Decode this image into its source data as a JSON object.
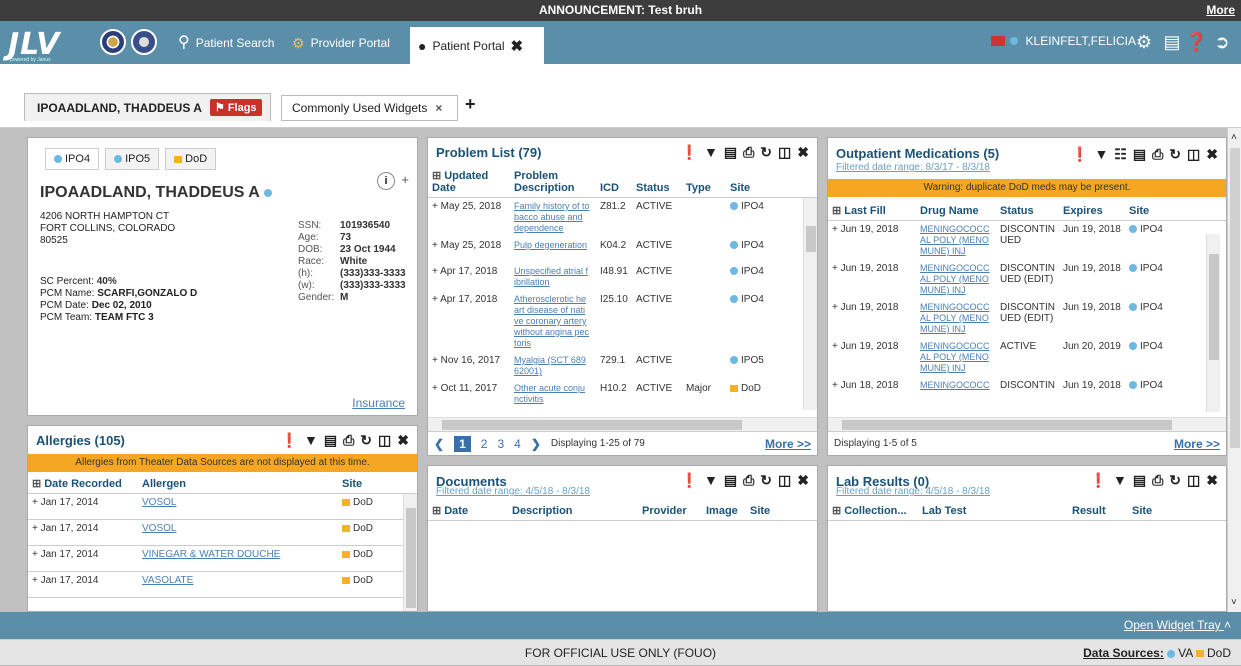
{
  "announcement": {
    "label": "ANNOUNCEMENT:",
    "text": "Test bruh",
    "more": "More"
  },
  "nav": {
    "logo": "JLV",
    "logo_sub": "powered by Janus",
    "patient_search": "Patient Search",
    "provider_portal": "Provider Portal",
    "patient_portal": "Patient Portal",
    "user": "KLEINFELT,FELICIA"
  },
  "tabs": {
    "patient": "IPOAADLAND, THADDEUS A",
    "flags": "Flags",
    "widgets": "Commonly Used Widgets"
  },
  "patient": {
    "tabs": [
      "IPO4",
      "IPO5",
      "DoD"
    ],
    "name": "IPOAADLAND, THADDEUS A",
    "addr1": "4206 NORTH HAMPTON CT",
    "addr2": "FORT COLLINS, COLORADO",
    "zip": "80525",
    "ssn_l": "SSN:",
    "ssn": "101936540",
    "age_l": "Age:",
    "age": "73",
    "dob_l": "DOB:",
    "dob": "23 Oct 1944",
    "race_l": "Race:",
    "race": "White",
    "h_l": "(h):",
    "h": "(333)333-3333",
    "w_l": "(w):",
    "w": "(333)333-3333",
    "gender_l": "Gender:",
    "gender": "M",
    "sc_l": "SC Percent:",
    "sc": "40%",
    "pcm_l": "PCM Name:",
    "pcm": "SCARFI,GONZALO D",
    "pcmd_l": "PCM Date:",
    "pcmd": "Dec 02, 2010",
    "team_l": "PCM Team:",
    "team": "TEAM FTC 3",
    "insurance": "Insurance"
  },
  "allergies": {
    "title": "Allergies (105)",
    "warning": "Allergies from Theater Data Sources are not displayed at this time.",
    "cols": [
      "Date Recorded",
      "Allergen",
      "Site"
    ],
    "rows": [
      [
        "Jan 17, 2014",
        "VOSOL",
        "DoD"
      ],
      [
        "Jan 17, 2014",
        "VOSOL",
        "DoD"
      ],
      [
        "Jan 17, 2014",
        "VINEGAR & WATER DOUCHE",
        "DoD"
      ],
      [
        "Jan 17, 2014",
        "VASOLATE",
        "DoD"
      ]
    ]
  },
  "problems": {
    "title": "Problem List (79)",
    "cols": [
      "Updated Date",
      "Problem Description",
      "ICD",
      "Status",
      "Type",
      "Site"
    ],
    "rows": [
      [
        "May 25, 2018",
        "Family history of to bacco abuse and dependence",
        "Z81.2",
        "ACTIVE",
        "",
        "IPO4"
      ],
      [
        "May 25, 2018",
        "Pulp degeneration",
        "K04.2",
        "ACTIVE",
        "",
        "IPO4"
      ],
      [
        "Apr 17, 2018",
        "Unspecified atrial f ibrillation",
        "I48.91",
        "ACTIVE",
        "",
        "IPO4"
      ],
      [
        "Apr 17, 2018",
        "Atherosclerotic he art disease of nati ve coronary artery without angina pec toris",
        "I25.10",
        "ACTIVE",
        "",
        "IPO4"
      ],
      [
        "Nov 16, 2017",
        "Myalgia (SCT 689 62001)",
        "729.1",
        "ACTIVE",
        "",
        "IPO5"
      ],
      [
        "Oct 11, 2017",
        "Other acute conju nctivitis",
        "H10.2",
        "ACTIVE",
        "Major",
        "DoD"
      ]
    ],
    "pages": [
      "1",
      "2",
      "3",
      "4"
    ],
    "displaying": "Displaying 1-25 of 79",
    "more": "More >>"
  },
  "documents": {
    "title": "Documents",
    "range": "Filtered date range: 4/5/18 - 8/3/18",
    "cols": [
      "Date",
      "Description",
      "Provider",
      "Image",
      "Site"
    ]
  },
  "meds": {
    "title": "Outpatient Medications (5)",
    "range": "Filtered date range: 8/3/17 - 8/3/18",
    "warning": "Warning: duplicate DoD meds may be present.",
    "cols": [
      "Last Fill",
      "Drug Name",
      "Status",
      "Expires",
      "Site"
    ],
    "rows": [
      [
        "Jun 19, 2018",
        "MENINGOCOCC AL POLY (MENO MUNE) INJ",
        "DISCONTIN UED",
        "Jun 19, 2018",
        "IPO4"
      ],
      [
        "Jun 19, 2018",
        "MENINGOCOCC AL POLY (MENO MUNE) INJ",
        "DISCONTIN UED (EDIT)",
        "Jun 19, 2018",
        "IPO4"
      ],
      [
        "Jun 19, 2018",
        "MENINGOCOCC AL POLY (MENO MUNE) INJ",
        "DISCONTIN UED (EDIT)",
        "Jun 19, 2018",
        "IPO4"
      ],
      [
        "Jun 19, 2018",
        "MENINGOCOCC AL POLY (MENO MUNE) INJ",
        "ACTIVE",
        "Jun 20, 2019",
        "IPO4"
      ],
      [
        "Jun 18, 2018",
        "MENINGOCOCC",
        "DISCONTIN",
        "Jun 19, 2018",
        "IPO4"
      ]
    ],
    "displaying": "Displaying 1-5 of 5",
    "more": "More >>"
  },
  "labs": {
    "title": "Lab Results (0)",
    "range": "Filtered date range: 4/5/18 - 8/3/18",
    "cols": [
      "Collection...",
      "Lab Test",
      "Result",
      "Site"
    ]
  },
  "tray": "Open Widget Tray",
  "footer": {
    "text": "FOR OFFICIAL USE ONLY (FOUO)",
    "ds": "Data Sources:",
    "va": "VA",
    "dod": "DoD"
  },
  "colors": {
    "header": "#5b8fa9",
    "accent": "#f5a623",
    "va": "#6cb9e3",
    "dod": "#f5b229"
  }
}
